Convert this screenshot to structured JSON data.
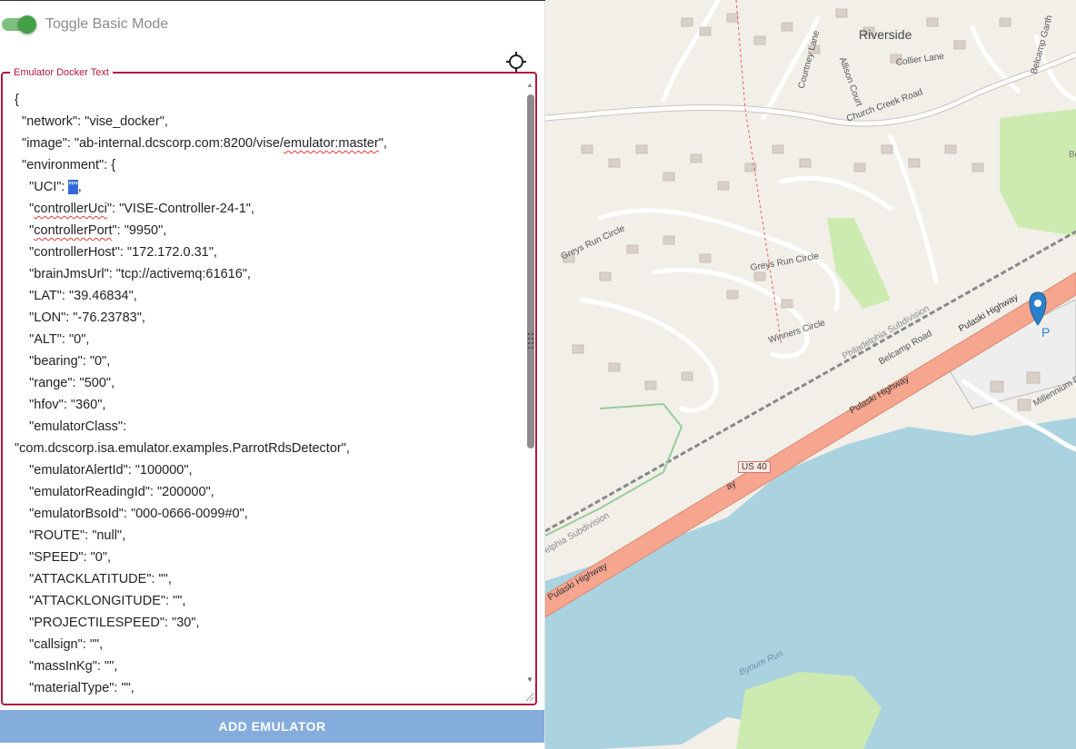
{
  "toggle": {
    "label": "Toggle Basic Mode",
    "on": true
  },
  "fieldset": {
    "legend": "Emulator Docker Text"
  },
  "docker_text": {
    "lines": [
      {
        "t": "{"
      },
      {
        "t": "  \"network\": \"vise_docker\","
      },
      {
        "t": "  \"image\": \"ab-internal.dcscorp.com:8200/vise/",
        "sq": "emulator:master",
        "after": "\","
      },
      {
        "t": "  \"environment\": {"
      },
      {
        "t": "    \"UCI\": ",
        "sel": "\"\"",
        "after": ","
      },
      {
        "t": "    \"",
        "sq": "controllerUci",
        "after": "\": \"VISE-Controller-24-1\","
      },
      {
        "t": "    \"",
        "sq": "controllerPort",
        "after": "\": \"9950\","
      },
      {
        "t": "    \"controllerHost\": \"172.172.0.31\","
      },
      {
        "t": "    \"brainJmsUrl\": \"tcp://activemq:61616\","
      },
      {
        "t": "    \"LAT\": \"39.46834\","
      },
      {
        "t": "    \"LON\": \"-76.23783\","
      },
      {
        "t": "    \"ALT\": \"0\","
      },
      {
        "t": "    \"bearing\": \"0\","
      },
      {
        "t": "    \"range\": \"500\","
      },
      {
        "t": "    \"hfov\": \"360\","
      },
      {
        "t": "    \"emulatorClass\":"
      },
      {
        "t": "\"com.dcscorp.isa.emulator.examples.ParrotRdsDetector\","
      },
      {
        "t": "    \"emulatorAlertId\": \"100000\","
      },
      {
        "t": "    \"emulatorReadingId\": \"200000\","
      },
      {
        "t": "    \"emulatorBsoId\": \"000-0666-0099#0\","
      },
      {
        "t": "    \"ROUTE\": \"null\","
      },
      {
        "t": "    \"SPEED\": \"0\","
      },
      {
        "t": "    \"ATTACKLATITUDE\": \"\","
      },
      {
        "t": "    \"ATTACKLONGITUDE\": \"\","
      },
      {
        "t": "    \"PROJECTILESPEED\": \"30\","
      },
      {
        "t": "    \"callsign\": \"\","
      },
      {
        "t": "    \"massInKg\": \"\","
      },
      {
        "t": "    \"materialType\": \"\","
      }
    ]
  },
  "add_button": {
    "label": "ADD EMULATOR"
  },
  "map": {
    "labels": {
      "riverside": "Riverside",
      "courtney_lane": "Courtney Lane",
      "allison_court": "Allison Court",
      "collier_lane": "Collier Lane",
      "belcamp_garth": "Belcamp Garth",
      "church_creek_road": "Church Creek Road",
      "greys_run_circle_1": "Greys Run Circle",
      "greys_run_circle_2": "Greys Run Circle",
      "winners_circle": "Winners Circle",
      "philadelphia_subdivision_1": "Philadelphia Subdivision",
      "philadelphia_subdivision_2": "elphia Subdivision",
      "belcamp_road": "Belcamp Road",
      "pulaski_highway_1": "Pulaski Highway",
      "pulaski_highway_2": "Pulaski Highway",
      "pulaski_highway_3": "Pulaski Highway",
      "pulaski_highway_4": "ay",
      "us40": "US 40",
      "millennium": "Millennium D",
      "bynum_run": "Bynum Run",
      "parking": "P",
      "be": "Be"
    },
    "colors": {
      "water": "#aad3df",
      "land": "#f2efe9",
      "highway": "#f6a58f",
      "park": "#cdebb0",
      "marker": "#2a81cb"
    }
  }
}
